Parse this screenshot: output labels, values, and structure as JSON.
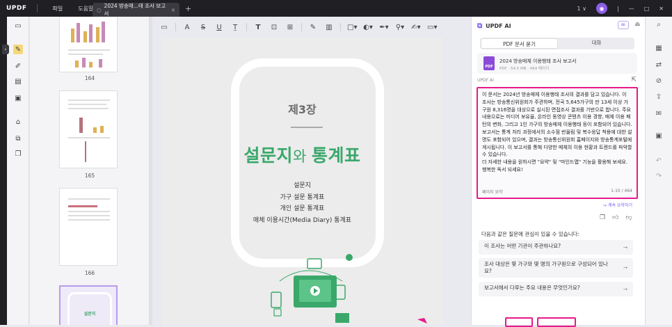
{
  "titlebar": {
    "logo": "UPDF",
    "menu": [
      "파일",
      "도움말"
    ],
    "tab_title": "2024 방송매...태 조사 보고서",
    "tab_close": "×",
    "new_tab": "+",
    "page_count_menu": "1 ∨",
    "avatar_initial": "◉"
  },
  "thumbnails": {
    "pages": [
      "164",
      "165",
      "166"
    ],
    "accent_color": "#8b4ad8"
  },
  "page": {
    "chapter": "제3장",
    "title_part1": "설문지",
    "title_part2": "와 ",
    "title_part3": "통계표",
    "lines": [
      "설문지",
      "가구 설문 통계표",
      "개인 설문 통계표",
      "매체 이용시간(Media Diary) 통계표"
    ],
    "title_color": "#3aa86b"
  },
  "ai_panel": {
    "title": "UPDF AI",
    "tabs": [
      "PDF 문서 묻기",
      "대화"
    ],
    "file_name": "2024 방송매체 이용행태 조사 보고서",
    "file_meta": "PDF · 54.5 MB · 464 페이지",
    "file_icon_label": "PDF",
    "section_label": "UPDF AI",
    "answer": [
      "이 문서는 2024년 방송매체 이용행태 조사의 결과를 담고 있습니다. 이 조사는 방송통신위원회가 주관하며, 전국 5,645가구의 만 13세 이상 가구원 8,316명을 대상으로 실시된 면접조사 결과를 기반으로 합니다. 주요 내용으로는 미디어 보유율, 온라인 동영상 콘텐츠 이용 경향, 매체 이용 패턴의 변화, 그리고 1인 가구의 방송매체 이용행태 등이 포함되어 있습니다.",
      "보고서는 통계 처리 과정에서의 소수점 반올림 및 복수응답 척용에 대한 설명도 포함되어 있으며, 결과는 방송통신위원회 홈페이지와 방송통계포털에 게시됩니다. 이 보고서를 통해 다양한 매체의 이용 현황과 트렌드를 파악할 수 있습니다.",
      "더 자세한 내용을 원하시면 \"요약\" 및 \"마인드맵\" 기능을 활용해 보세요. 행복한 독서 되세요!"
    ],
    "answer_footer_left": "페이지 요약",
    "answer_footer_right": "1-10 / 464",
    "continue": "↪ 계속 요약하기",
    "suggest_intro": "다음과 같은 질문에 관심이 있을 수 있습니다:",
    "questions": [
      "이 조사는 어떤 기관이 주관하나요?",
      "조사 대상은 몇 가구와 몇 명의 가구원으로 구성되어 있나요?",
      "보고서에서 다루는 주요 내용은 무엇인가요?"
    ],
    "highlight_color": "#e6198a"
  }
}
